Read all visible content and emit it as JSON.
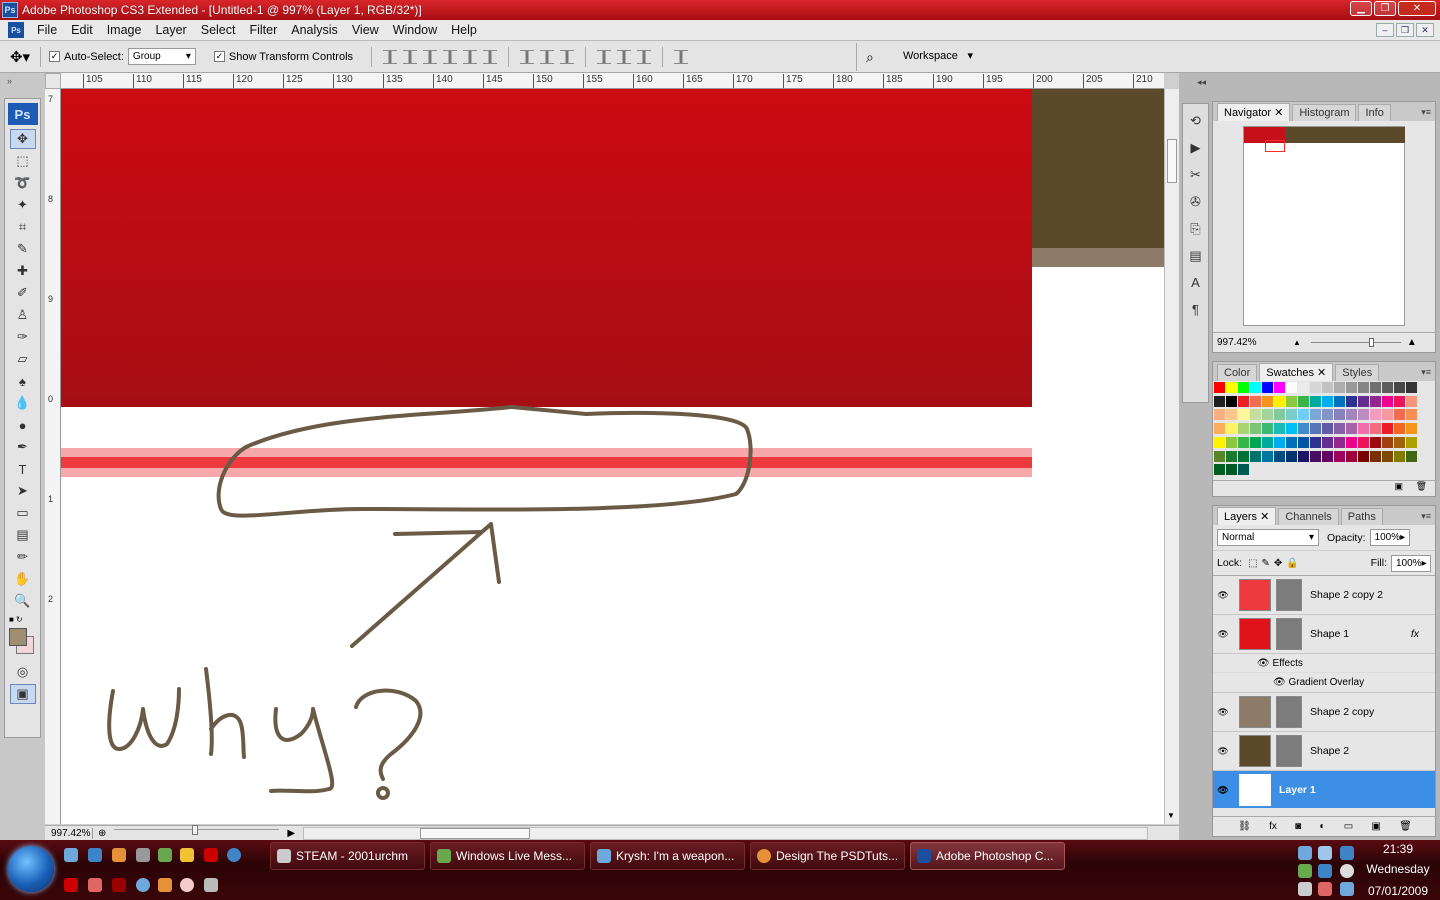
{
  "window": {
    "title": "Adobe Photoshop CS3 Extended - [Untitled-1 @ 997% (Layer 1, RGB/32*)]",
    "app_icon": "Ps"
  },
  "menu": [
    "File",
    "Edit",
    "Image",
    "Layer",
    "Select",
    "Filter",
    "Analysis",
    "View",
    "Window",
    "Help"
  ],
  "options": {
    "auto_select_label": "Auto-Select:",
    "auto_select_value": "Group",
    "show_transform_label": "Show Transform Controls",
    "workspace_label": "Workspace"
  },
  "ruler": {
    "h": [
      "105",
      "110",
      "115",
      "120",
      "125",
      "130",
      "135",
      "140",
      "145",
      "150",
      "155",
      "160",
      "165",
      "170",
      "175",
      "180",
      "185",
      "190",
      "195",
      "200",
      "205",
      "210"
    ],
    "v": [
      "7",
      "8",
      "9",
      "0",
      "1",
      "2"
    ]
  },
  "canvas": {
    "annotation": "Why?",
    "colors": {
      "red_top": "#cd0a12",
      "red_bottom": "#a60e14",
      "brown": "#5a4a2a",
      "taupe": "#8c7c67",
      "stripe_light": "#f7a8a8",
      "stripe_dark": "#ec3a3e",
      "ink": "#6b5a45"
    }
  },
  "status": {
    "zoom": "997.42%"
  },
  "navigator": {
    "tabs": [
      "Navigator",
      "Histogram",
      "Info"
    ],
    "zoom": "997.42%"
  },
  "color_panel": {
    "tabs": [
      "Color",
      "Swatches",
      "Styles"
    ]
  },
  "layers_panel": {
    "tabs": [
      "Layers",
      "Channels",
      "Paths"
    ],
    "blend_mode": "Normal",
    "opacity_label": "Opacity:",
    "opacity": "100%",
    "lock_label": "Lock:",
    "fill_label": "Fill:",
    "fill": "100%",
    "effects_label": "Effects",
    "gradient_overlay_label": "Gradient Overlay",
    "layers": [
      {
        "name": "Shape 2 copy 2",
        "color": "#ec3a3e"
      },
      {
        "name": "Shape 1",
        "color": "#e0121a"
      },
      {
        "name": "Shape 2 copy",
        "color": "#8c7c67"
      },
      {
        "name": "Shape 2",
        "color": "#5a4a2a"
      },
      {
        "name": "Layer 1",
        "color": "#ffffff"
      }
    ]
  },
  "taskbar": {
    "buttons": [
      "STEAM - 2001urchm",
      "Windows Live Mess...",
      "Krysh: I'm a weapon...",
      "Design The PSDTuts...",
      "Adobe Photoshop C..."
    ],
    "time": "21:39",
    "day": "Wednesday",
    "date": "07/01/2009"
  }
}
